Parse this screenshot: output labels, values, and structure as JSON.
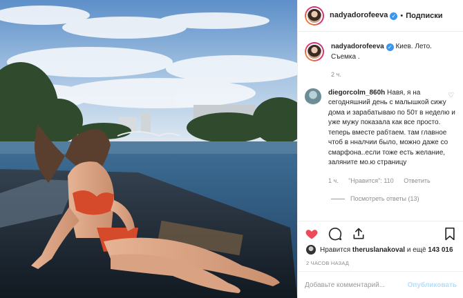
{
  "header": {
    "username": "nadyadorofeeva",
    "separator": "•",
    "follow_label": "Подписки"
  },
  "caption": {
    "username": "nadyadorofeeva",
    "text": "Киев. Лето. Съемка .",
    "age": "2 ч."
  },
  "comment": {
    "username": "diegorcolm_860h",
    "text": "Навя, я на сегодняшний день с малышкой сижу дома и зарабатываю по 50т в неделю и уже мужу показала как все просто. теперь вместе рабтаем. там главное чтоб в ннaлчии было, можно даже со смарфона..если тоже есть желание, заляните мо.ю страницу",
    "age": "1 ч.",
    "likes": "\"Нравится\": 110",
    "reply_label": "Ответить",
    "view_replies": "Посмотреть ответы (13)"
  },
  "likes": {
    "prefix": "Нравится",
    "user": "theruslanakoval",
    "suffix": "и ещё",
    "count": "143 016"
  },
  "timestamp": "2 ЧАСОВ НАЗАД",
  "add_comment": {
    "placeholder": "Добавьте комментарий...",
    "publish_label": "Опубликовать"
  },
  "icons": {
    "like": "heart-icon",
    "comment": "comment-icon",
    "share": "share-icon",
    "save": "bookmark-icon",
    "verified": "verified-badge-icon"
  },
  "colors": {
    "like_red": "#ed4956",
    "verified_blue": "#3897f0",
    "publish_disabled": "#b2dffc",
    "muted": "#8e8e8e"
  }
}
